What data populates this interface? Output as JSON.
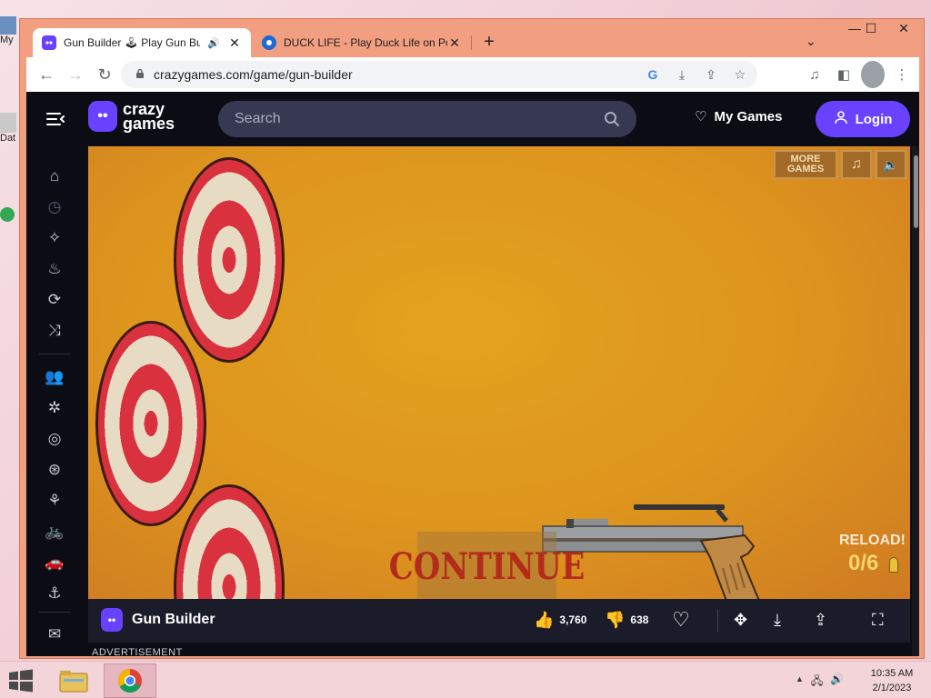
{
  "browser": {
    "tabs": [
      {
        "title": "Gun Builder 🕹 Play Gun Builder on CrazyGames",
        "audio": "🔊",
        "close": "✕"
      },
      {
        "title": "DUCK LIFE - Play Duck Life on Poki",
        "close": "✕"
      }
    ],
    "new_tab": "+",
    "tab_dropdown": "⌄",
    "window_controls": {
      "minimize": "—",
      "maximize": "☐",
      "close": "✕"
    },
    "nav": {
      "back": "←",
      "forward": "→",
      "reload": "↻"
    },
    "url": "crazygames.com/game/gun-builder",
    "omni_icons": {
      "google": "G",
      "install": "⤓",
      "share": "⇪",
      "bookmark": "☆"
    },
    "toolbar_right": {
      "media": "♫",
      "side_panel": "◧",
      "menu": "⋮"
    }
  },
  "site": {
    "logo_text_1": "crazy",
    "logo_text_2": "games",
    "logo_glyph": "••",
    "search_placeholder": "Search",
    "my_games_label": "My Games",
    "my_games_icon": "♡",
    "login_label": "Login",
    "login_icon": "👤",
    "sidebar_icons": [
      "⌂",
      "◷",
      "✧",
      "♨",
      "⟳",
      "⤨",
      "👥",
      "✲",
      "◎",
      "⊛",
      "⚘",
      "🚲",
      "🚗",
      "⚓",
      "✉"
    ]
  },
  "game": {
    "more_games_label": "MORE GAMES",
    "music_icon": "♫",
    "sound_icon": "🔈",
    "continue_label": "CONTINUE",
    "reload_label": "RELOAD!",
    "ammo": "0/6"
  },
  "game_bar": {
    "logo_glyph": "••",
    "title": "Gun Builder",
    "like_icon": "👍",
    "likes": "3,760",
    "dislike_icon": "👎",
    "dislikes": "638",
    "favorite_icon": "♡",
    "controls_icon": "✥",
    "download_icon": "⤓",
    "share_icon": "⇪",
    "fullscreen_icon": "⛶"
  },
  "advertisement_label": "ADVERTISEMENT",
  "desktop": {
    "icon_label_1": "My",
    "icon_label_2": "Dat"
  },
  "taskbar": {
    "tray_up": "▲",
    "tray_network": "🖧",
    "tray_volume": "🔊",
    "time": "10:35 AM",
    "date": "2/1/2023"
  },
  "colors": {
    "crazygames_purple": "#6842ff",
    "game_background": "#dd941e",
    "target_red": "#d9313e",
    "target_cream": "#e7dcc3",
    "browser_frame": "#f29e80"
  }
}
